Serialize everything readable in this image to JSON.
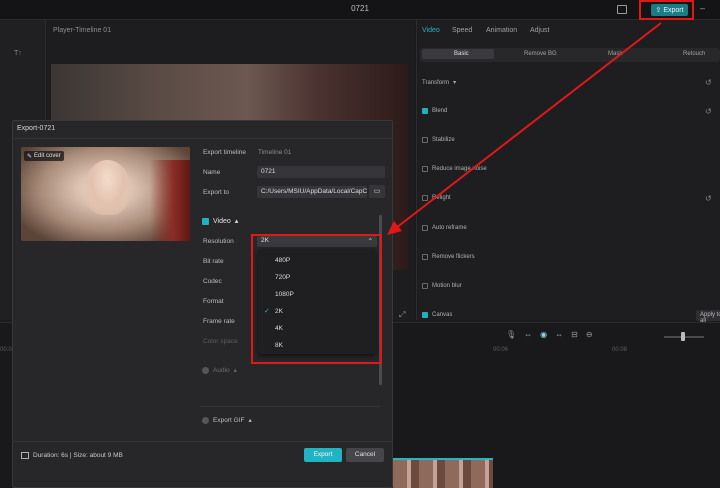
{
  "app": {
    "title": "0721"
  },
  "topbar": {
    "export_label": "Export"
  },
  "player": {
    "title": "Player-Timeline 01"
  },
  "left_panel": {
    "label": "T↑"
  },
  "right_panel": {
    "tabs": [
      "Video",
      "Speed",
      "Animation",
      "Adjust"
    ],
    "subtabs": [
      "Basic",
      "Remove BG",
      "Mask",
      "Retouch"
    ],
    "props": [
      "Transform",
      "Blend",
      "Stabilize",
      "Reduce image noise",
      "Relight",
      "Auto reframe",
      "Remove flickers",
      "Motion blur",
      "Canvas"
    ],
    "apply_label": "Apply to all"
  },
  "timeline": {
    "ticks": [
      "00:00",
      "00:06",
      "00:08"
    ]
  },
  "dialog": {
    "title": "Export-0721",
    "edit_cover": "Edit cover",
    "export_timeline_label": "Export timeline",
    "export_timeline_value": "Timeline 01",
    "name_label": "Name",
    "name_value": "0721",
    "export_to_label": "Export to",
    "export_to_value": "C:/Users/MSIU/AppData/Local/CapC...",
    "video_label": "Video",
    "resolution_label": "Resolution",
    "resolution_value": "2K",
    "bitrate_label": "Bit rate",
    "codec_label": "Codec",
    "format_label": "Format",
    "framerate_label": "Frame rate",
    "colorspace_label": "Color space",
    "audio_label": "Audio",
    "gif_label": "Export GIF",
    "resolution_options": [
      "480P",
      "720P",
      "1080P",
      "2K",
      "4K",
      "8K"
    ],
    "selected_option": "2K",
    "duration_text": "Duration: 6s | Size: about 9 MB",
    "export_button": "Export",
    "cancel_button": "Cancel"
  },
  "colors": {
    "accent": "#22b3c3",
    "annotation": "#e01818"
  }
}
